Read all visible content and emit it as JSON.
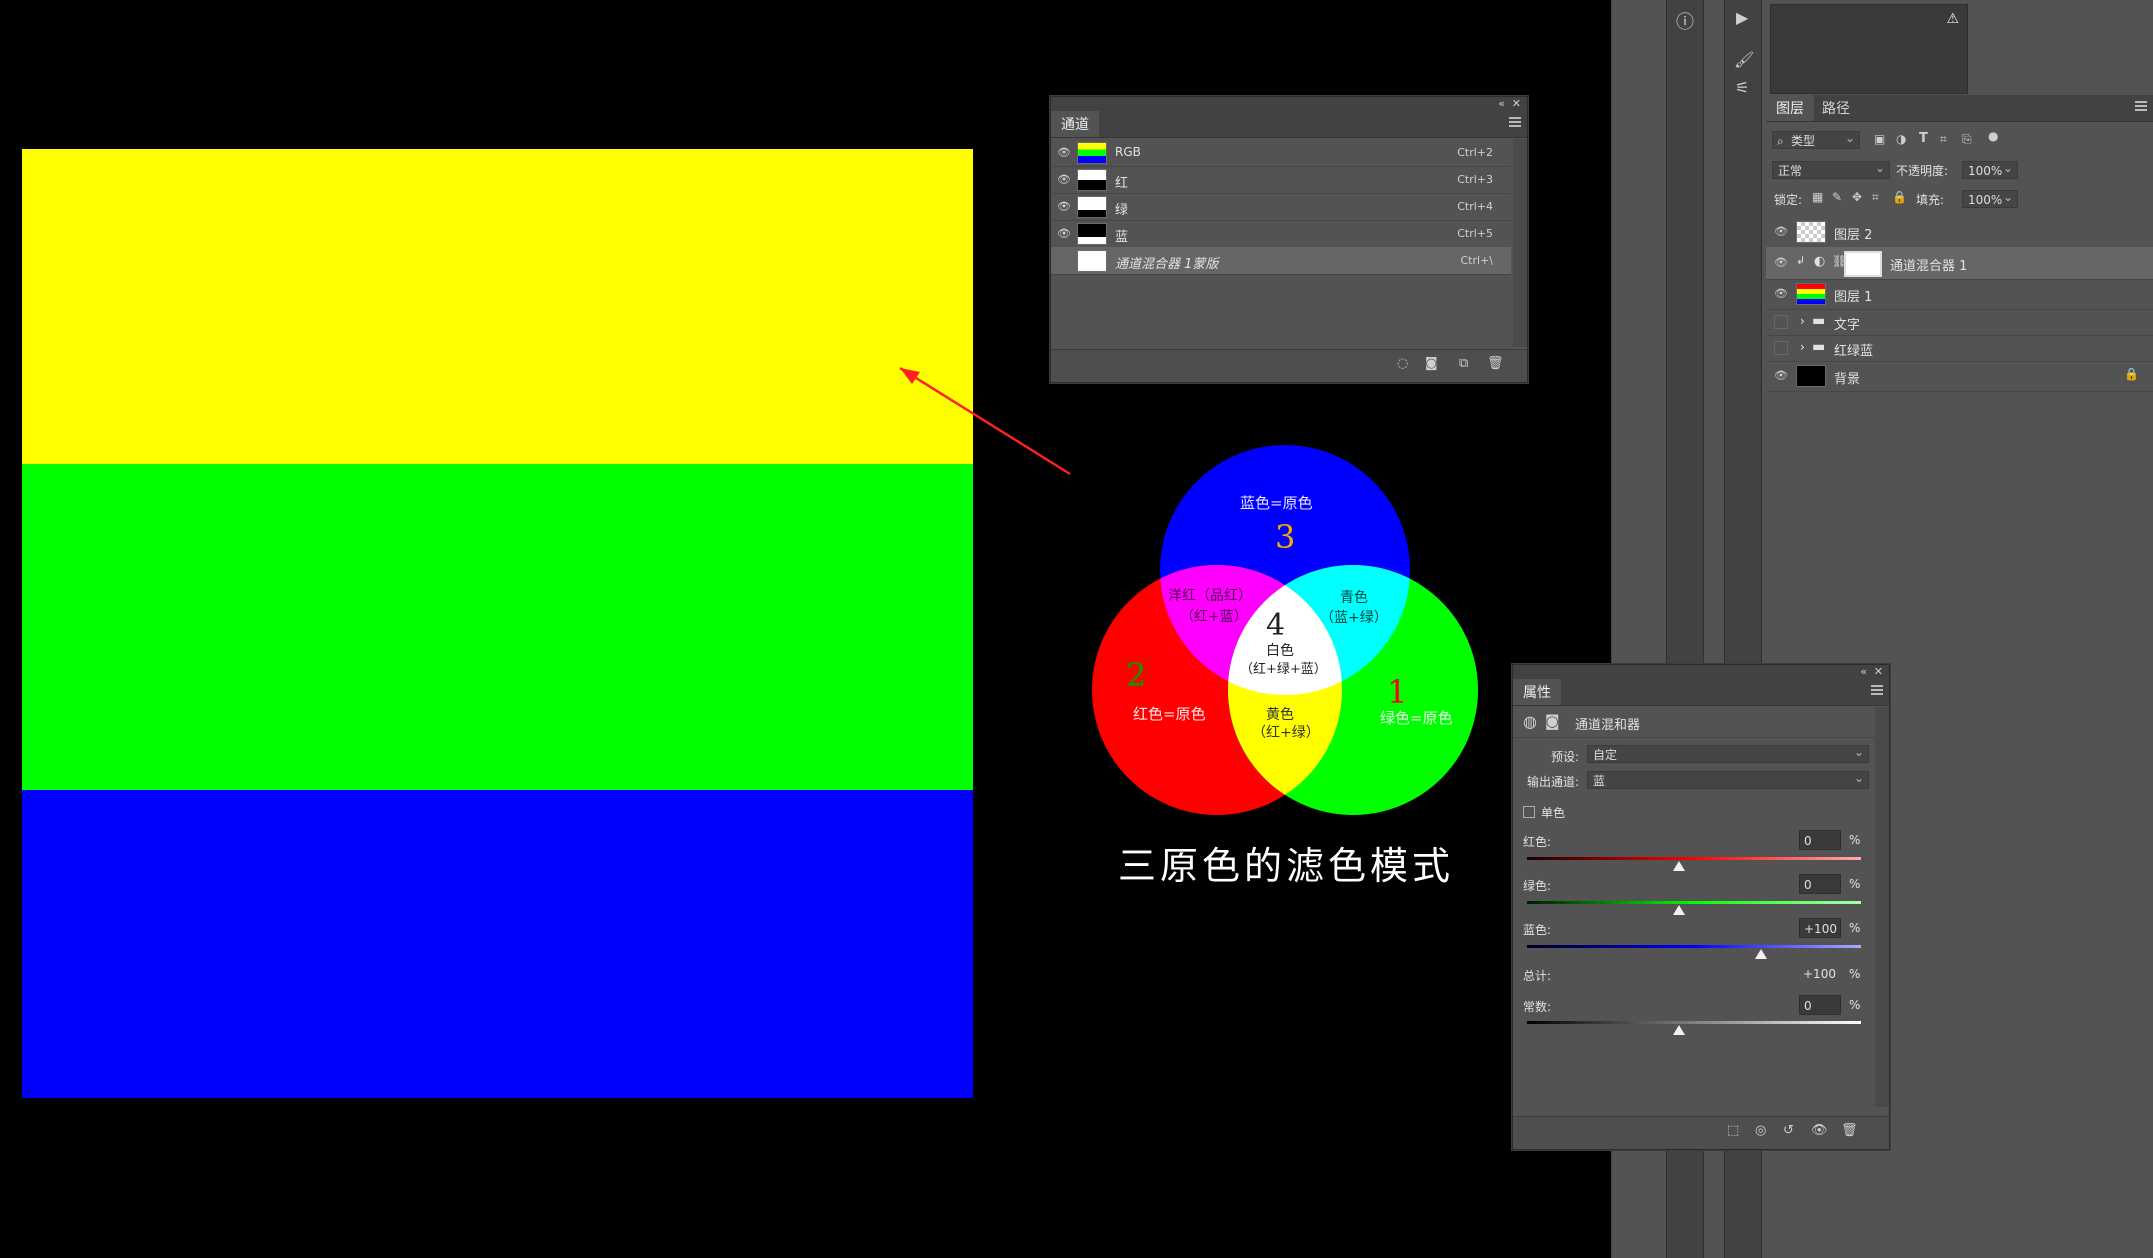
{
  "canvas": {
    "colors": {
      "yellow": "#ffff00",
      "green": "#00ff00",
      "blue": "#0000ff"
    },
    "venn": {
      "blue_label": "蓝色=原色",
      "blue_num": "3",
      "red_label": "红色=原色",
      "red_num": "2",
      "green_label": "绿色=原色",
      "green_num": "1",
      "magenta_label": "洋红（品红）",
      "magenta_sub": "（红+蓝）",
      "cyan_label": "青色",
      "cyan_sub": "（蓝+绿）",
      "white_num": "4",
      "white_label": "白色",
      "white_sub": "（红+绿+蓝）",
      "yellow_label": "黄色",
      "yellow_sub": "（红+绿）",
      "caption": "三原色的滤色模式"
    }
  },
  "channels_panel": {
    "tab": "通道",
    "rows": [
      {
        "name": "RGB",
        "shortcut": "Ctrl+2"
      },
      {
        "name": "红",
        "shortcut": "Ctrl+3"
      },
      {
        "name": "绿",
        "shortcut": "Ctrl+4"
      },
      {
        "name": "蓝",
        "shortcut": "Ctrl+5"
      },
      {
        "name": "通道混合器 1蒙版",
        "shortcut": "Ctrl+\\"
      }
    ]
  },
  "layers_panel": {
    "tabs": [
      "图层",
      "路径"
    ],
    "filter": "类型",
    "blend_mode": "正常",
    "opacity_label": "不透明度:",
    "opacity_value": "100%",
    "lock_label": "锁定:",
    "fill_label": "填充:",
    "fill_value": "100%",
    "layers": [
      {
        "name": "图层 2"
      },
      {
        "name": "通道混合器 1"
      },
      {
        "name": "图层 1"
      },
      {
        "name": "文字"
      },
      {
        "name": "红绿蓝"
      },
      {
        "name": "背景"
      }
    ]
  },
  "properties_panel": {
    "tab": "属性",
    "title": "通道混和器",
    "preset_label": "预设:",
    "preset_value": "自定",
    "output_label": "输出通道:",
    "output_value": "蓝",
    "mono_label": "单色",
    "red_label": "红色:",
    "red_value": "0",
    "green_label": "绿色:",
    "green_value": "0",
    "blue_label": "蓝色:",
    "blue_value": "+100",
    "total_label": "总计:",
    "total_value": "+100",
    "const_label": "常数:",
    "const_value": "0",
    "percent": "%",
    "slider_levels": {
      "red": 0,
      "green": 0,
      "blue": 100,
      "constant": 0
    }
  }
}
